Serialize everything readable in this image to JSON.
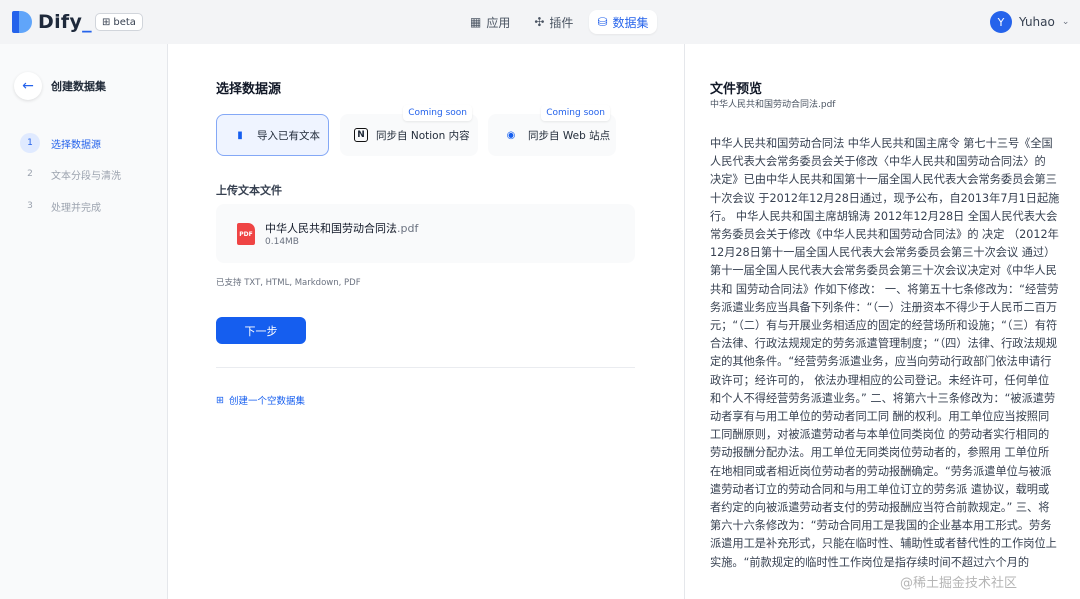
{
  "header": {
    "logo_text": "Dify",
    "beta_label": "beta",
    "nav": [
      {
        "label": "应用",
        "icon": "grid-icon"
      },
      {
        "label": "插件",
        "icon": "puzzle-icon"
      },
      {
        "label": "数据集",
        "icon": "database-icon",
        "active": true
      }
    ],
    "user_initial": "Y",
    "user_name": "Yuhao"
  },
  "sidebar": {
    "title": "创建数据集",
    "steps": [
      {
        "num": "1",
        "label": "选择数据源",
        "active": true
      },
      {
        "num": "2",
        "label": "文本分段与清洗"
      },
      {
        "num": "3",
        "label": "处理并完成"
      }
    ]
  },
  "main": {
    "section_title": "选择数据源",
    "sources": [
      {
        "label": "导入已有文本",
        "icon": "file-icon",
        "active": true
      },
      {
        "label": "同步自 Notion 内容",
        "icon": "notion-icon",
        "badge": "Coming soon"
      },
      {
        "label": "同步自 Web 站点",
        "icon": "web-icon",
        "badge": "Coming soon"
      }
    ],
    "upload_title": "上传文本文件",
    "file": {
      "name": "中华人民共和国劳动合同法",
      "ext": ".pdf",
      "size": "0.14MB",
      "icon_text": "PDF"
    },
    "support_text": "已支持 TXT, HTML, Markdown, PDF",
    "next_label": "下一步",
    "empty_dataset_label": "创建一个空数据集"
  },
  "preview": {
    "title": "文件预览",
    "file_name": "中华人民共和国劳动合同法.pdf",
    "body": "中华人民共和国劳动合同法 中华人民共和国主席令 第七十三号《全国人民代表大会常务委员会关于修改〈中华人民共和国劳动合同法〉的 决定》已由中华人民共和国第十一届全国人民代表大会常务委员会第三十次会议 于2012年12月28日通过，现予公布，自2013年7月1日起施行。 中华人民共和国主席胡锦涛 2012年12月28日 全国人民代表大会常务委员会关于修改《中华人民共和国劳动合同法》的 决定 （2012年12月28日第十一届全国人民代表大会常务委员会第三十次会议 通过） 第十一届全国人民代表大会常务委员会第三十次会议决定对《中华人民共和 国劳动合同法》作如下修改： 一、将第五十七条修改为：“经营劳务派遣业务应当具备下列条件：“（一）注册资本不得少于人民币二百万元；“（二）有与开展业务相适应的固定的经营场所和设施；“（三）有符合法律、行政法规规定的劳务派遣管理制度；“（四）法律、行政法规规定的其他条件。“经营劳务派遣业务，应当向劳动行政部门依法申请行政许可；经许可的， 依法办理相应的公司登记。未经许可，任何单位和个人不得经营劳务派遣业务。” 二、将第六十三条修改为：“被派遣劳动者享有与用工单位的劳动者同工同 酬的权利。用工单位应当按照同工同酬原则，对被派遣劳动者与本单位同类岗位 的劳动者实行相同的劳动报酬分配办法。用工单位无同类岗位劳动者的，参照用 工单位所在地相同或者相近岗位劳动者的劳动报酬确定。“劳务派遣单位与被派遣劳动者订立的劳动合同和与用工单位订立的劳务派 遣协议，载明或者约定的向被派遣劳动者支付的劳动报酬应当符合前款规定。” 三、将第六十六条修改为：“劳动合同用工是我国的企业基本用工形式。劳务派遣用工是补充形式，只能在临时性、辅助性或者替代性的工作岗位上实施。“前款规定的临时性工作岗位是指存续时间不超过六个月的"
  },
  "watermark": "@稀土掘金技术社区"
}
